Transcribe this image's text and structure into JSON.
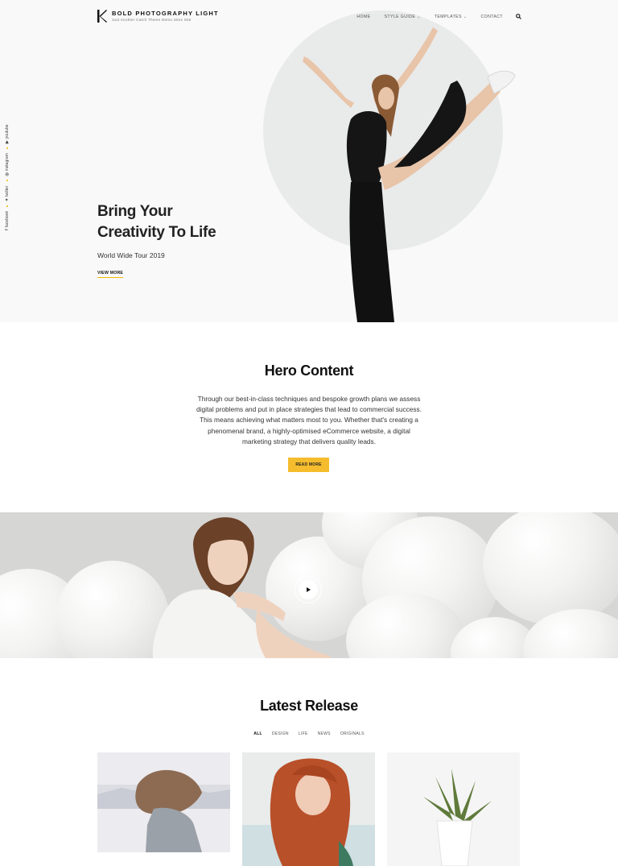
{
  "site": {
    "title": "BOLD PHOTOGRAPHY LIGHT",
    "tagline": "Just Another Catch Theme Demo Sites Site"
  },
  "nav": {
    "items": [
      {
        "label": "HOME"
      },
      {
        "label": "STYLE GUIDE"
      },
      {
        "label": "TEMPLATES"
      },
      {
        "label": "CONTACT"
      }
    ]
  },
  "social": {
    "facebook": "facebook",
    "twitter": "twitter",
    "instagram": "instagram",
    "youtube": "youtube"
  },
  "hero": {
    "title": "Bring Your Creativity To Life",
    "subtitle": "World Wide Tour 2019",
    "link": "VIEW MORE"
  },
  "hero_content": {
    "title": "Hero Content",
    "text": "Through our best-in-class techniques and bespoke growth plans we assess digital problems and put in place strategies that lead to commercial success. This means achieving what matters most to you. Whether that's creating a phenomenal brand, a highly-optimised eCommerce website, a digital marketing strategy that delivers quality leads.",
    "button": "READ MORE"
  },
  "latest_release": {
    "title": "Latest Release",
    "filters": [
      {
        "label": "ALL"
      },
      {
        "label": "DESIGN"
      },
      {
        "label": "LIFE"
      },
      {
        "label": "NEWS"
      },
      {
        "label": "ORIGINALS"
      }
    ]
  },
  "colors": {
    "accent": "#f5bd2d",
    "hero_bg": "#f8f9f8",
    "circle": "#e9eaea"
  }
}
